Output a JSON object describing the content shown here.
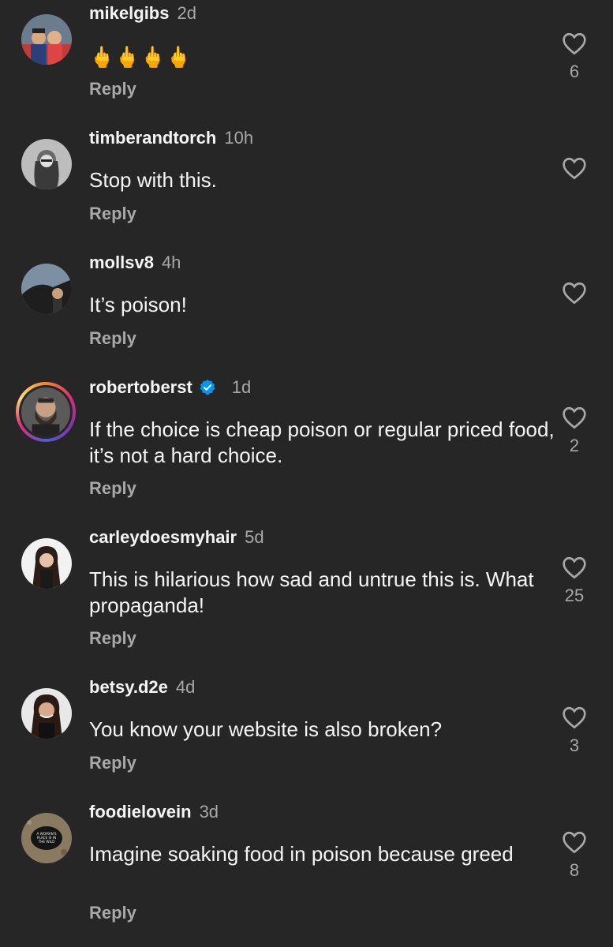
{
  "reply_label": "Reply",
  "colors": {
    "background": "#262626",
    "text": "#f5f5f5",
    "secondary": "#a8a8a8",
    "verified": "#0095f6"
  },
  "comments": [
    {
      "username": "mikelgibs",
      "time": "2d",
      "text": "🖕🖕🖕🖕",
      "likes": "6",
      "verified": false
    },
    {
      "username": "timberandtorch",
      "time": "10h",
      "text": "Stop with this.",
      "likes": "",
      "verified": false
    },
    {
      "username": "mollsv8",
      "time": "4h",
      "text": "It’s poison!",
      "likes": "",
      "verified": false
    },
    {
      "username": "robertoberst",
      "time": "1d",
      "text": "If the choice is cheap poison or regular priced food, it’s not a hard choice.",
      "likes": "2",
      "verified": true
    },
    {
      "username": "carleydoesmyhair",
      "time": "5d",
      "text": "This is hilarious how sad and untrue this is. What propaganda!",
      "likes": "25",
      "verified": false
    },
    {
      "username": "betsy.d2e",
      "time": "4d",
      "text": "You know your website is also broken?",
      "likes": "3",
      "verified": false
    },
    {
      "username": "foodielovein",
      "time": "3d",
      "text": "Imagine soaking food in poison because greed",
      "likes": "8",
      "verified": false
    }
  ],
  "avatar_badge_text": "A WOMAN'S PLACE IS IN THE WILD"
}
